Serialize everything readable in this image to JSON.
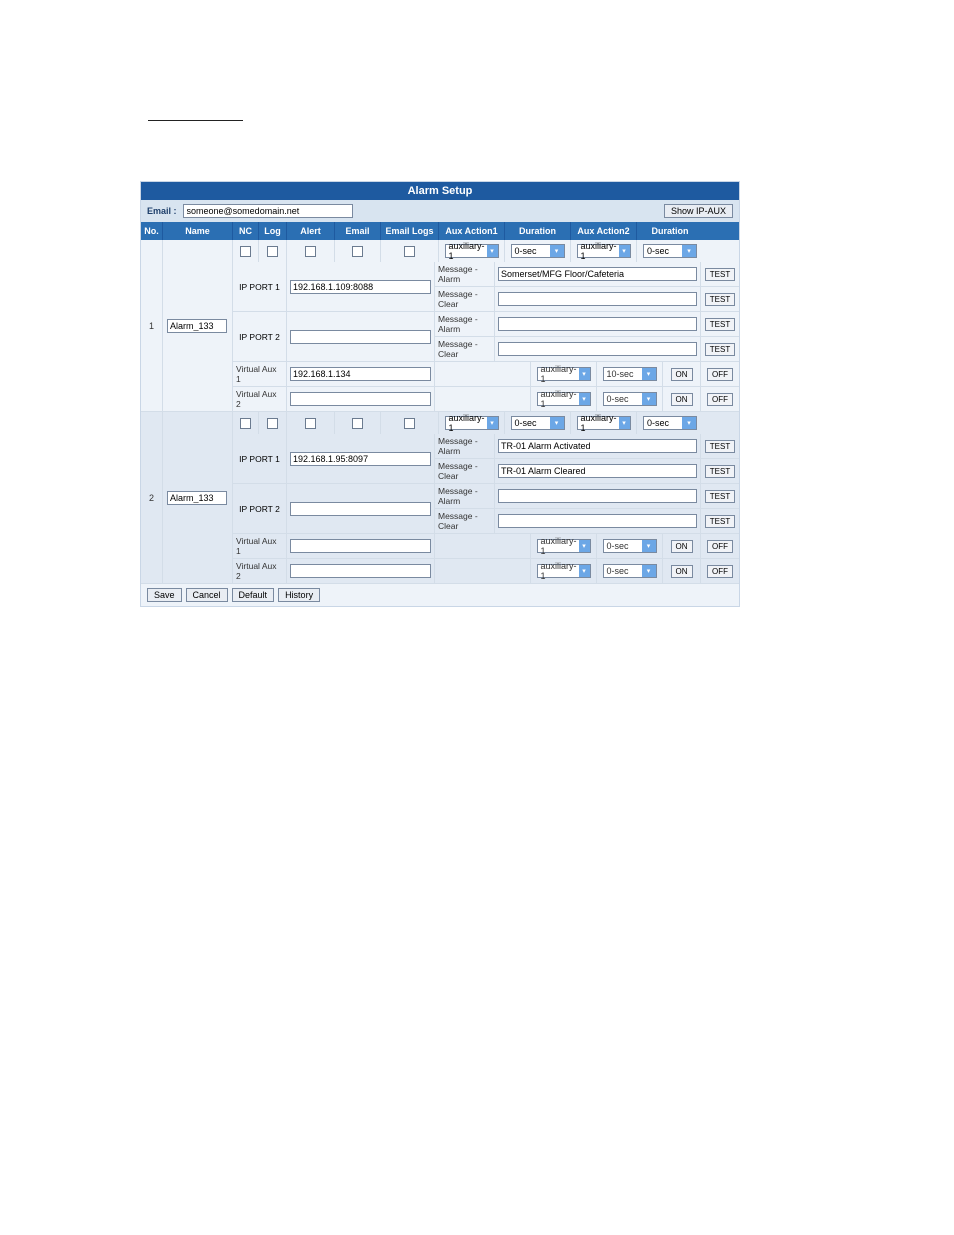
{
  "decor_label": "",
  "title": "Alarm Setup",
  "email_label": "Email :",
  "email_value": "someone@somedomain.net",
  "show_ipaux": "Show IP-AUX",
  "headers": {
    "no": "No.",
    "name": "Name",
    "nc": "NC",
    "log": "Log",
    "alert": "Alert",
    "email": "Email",
    "elogs": "Email Logs",
    "aux1": "Aux Action1",
    "dur1": "Duration",
    "aux2": "Aux Action2",
    "dur2": "Duration"
  },
  "labels": {
    "ipport1": "IP PORT 1",
    "ipport2": "IP PORT 2",
    "vaux1": "Virtual Aux 1",
    "vaux2": "Virtual Aux 2",
    "msg_alarm": "Message - Alarm",
    "msg_clear": "Message - Clear"
  },
  "buttons": {
    "test": "TEST",
    "on": "ON",
    "off": "OFF",
    "save": "Save",
    "cancel": "Cancel",
    "default": "Default",
    "history": "History"
  },
  "alarms": [
    {
      "no": "1",
      "name": "Alarm_133",
      "top": {
        "aux1": "auxiliary-1",
        "dur1": "0-sec",
        "aux2": "auxiliary-1",
        "dur2": "0-sec"
      },
      "ipport1_addr": "192.168.1.109:8088",
      "ipport1_alarm_msg": "Somerset/MFG Floor/Cafeteria",
      "ipport1_clear_msg": "",
      "ipport2_addr": "",
      "ipport2_alarm_msg": "",
      "ipport2_clear_msg": "",
      "vaux1_addr": "192.168.1.134",
      "vaux1_aux": "auxiliary-1",
      "vaux1_dur": "10-sec",
      "vaux2_addr": "",
      "vaux2_aux": "auxiliary-1",
      "vaux2_dur": "0-sec"
    },
    {
      "no": "2",
      "name": "Alarm_133",
      "top": {
        "aux1": "auxiliary-1",
        "dur1": "0-sec",
        "aux2": "auxiliary-1",
        "dur2": "0-sec"
      },
      "ipport1_addr": "192.168.1.95:8097",
      "ipport1_alarm_msg": "TR-01 Alarm Activated",
      "ipport1_clear_msg": "TR-01 Alarm Cleared",
      "ipport2_addr": "",
      "ipport2_alarm_msg": "",
      "ipport2_clear_msg": "",
      "vaux1_addr": "",
      "vaux1_aux": "auxiliary-1",
      "vaux1_dur": "0-sec",
      "vaux2_addr": "",
      "vaux2_aux": "auxiliary-1",
      "vaux2_dur": "0-sec"
    }
  ]
}
